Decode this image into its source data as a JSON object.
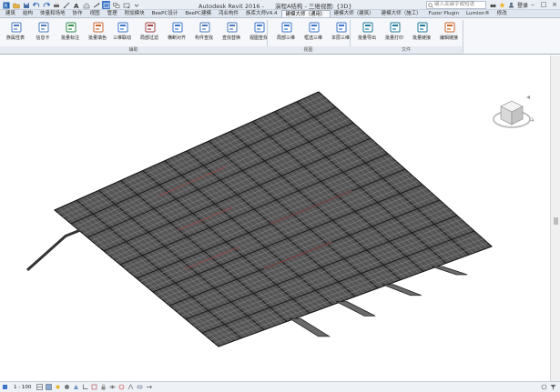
{
  "window": {
    "app_name": "Autodesk Revit 2016 -",
    "document_title": "演程A结构 - 三维视图: {3D}",
    "search_placeholder": "键入关键字或短语",
    "user_label": "登录"
  },
  "ribbon_tabs": [
    {
      "label": "建筑",
      "active": false
    },
    {
      "label": "结构",
      "active": false
    },
    {
      "label": "体量和场地",
      "active": false
    },
    {
      "label": "协作",
      "active": false
    },
    {
      "label": "视图",
      "active": false
    },
    {
      "label": "管理",
      "active": false
    },
    {
      "label": "附加模块",
      "active": false
    },
    {
      "label": "BeePC设计",
      "active": false
    },
    {
      "label": "BeePC建模",
      "active": false
    },
    {
      "label": "鸿业构件",
      "active": false
    },
    {
      "label": "族库大师V4.4",
      "active": false
    },
    {
      "label": "建模大师（通用）",
      "active": true
    },
    {
      "label": "建模大师（建筑）",
      "active": false
    },
    {
      "label": "建模大师（施工）",
      "active": false
    },
    {
      "label": "Fuzor Plugin",
      "active": false
    },
    {
      "label": "Lumion®",
      "active": false
    },
    {
      "label": "修改",
      "active": false
    }
  ],
  "ribbon_buttons": [
    {
      "id": "props",
      "label": "族属性表",
      "icon": "properties-icon"
    },
    {
      "id": "card",
      "label": "信息卡",
      "icon": "info-card-icon"
    },
    {
      "id": "batch-mark",
      "label": "批量标注",
      "icon": "batch-mark-icon"
    },
    {
      "id": "batch-color",
      "label": "批量填色",
      "icon": "batch-color-icon"
    },
    {
      "id": "3d-link",
      "label": "三维联动",
      "icon": "3d-link-icon"
    },
    {
      "id": "filter",
      "label": "局部过滤",
      "icon": "filter-icon"
    },
    {
      "id": "align",
      "label": "横断对齐",
      "icon": "align-icon"
    },
    {
      "id": "elem-search",
      "label": "构件查找",
      "icon": "element-search-icon"
    },
    {
      "id": "find-replace",
      "label": "查找替换",
      "icon": "find-replace-icon"
    },
    {
      "id": "view-find",
      "label": "视图查找",
      "icon": "view-find-icon"
    },
    {
      "id": "local-3d",
      "label": "局部三维",
      "icon": "local-3d-icon"
    },
    {
      "id": "select-3d",
      "label": "框选三维",
      "icon": "select-3d-icon"
    },
    {
      "id": "floor-3d",
      "label": "本层三维",
      "icon": "floor-3d-icon"
    },
    {
      "id": "batch-export",
      "label": "批量导出",
      "icon": "batch-export-icon"
    },
    {
      "id": "batch-print",
      "label": "批量打印",
      "icon": "batch-print-icon"
    },
    {
      "id": "batch-link",
      "label": "批量链接",
      "icon": "batch-link-icon"
    },
    {
      "id": "edit-link",
      "label": "编辑链接",
      "icon": "edit-link-icon"
    }
  ],
  "ribbon_panels": [
    {
      "label": "辅助"
    },
    {
      "label": "视图"
    },
    {
      "label": "文件"
    }
  ],
  "status_bar": {
    "scale": "1 : 100"
  },
  "colors": {
    "accent": "#3b73c8",
    "model_dark": "#3a3a3a",
    "model_light": "#8c8c8c",
    "model_highlight": "#a24a4a"
  }
}
